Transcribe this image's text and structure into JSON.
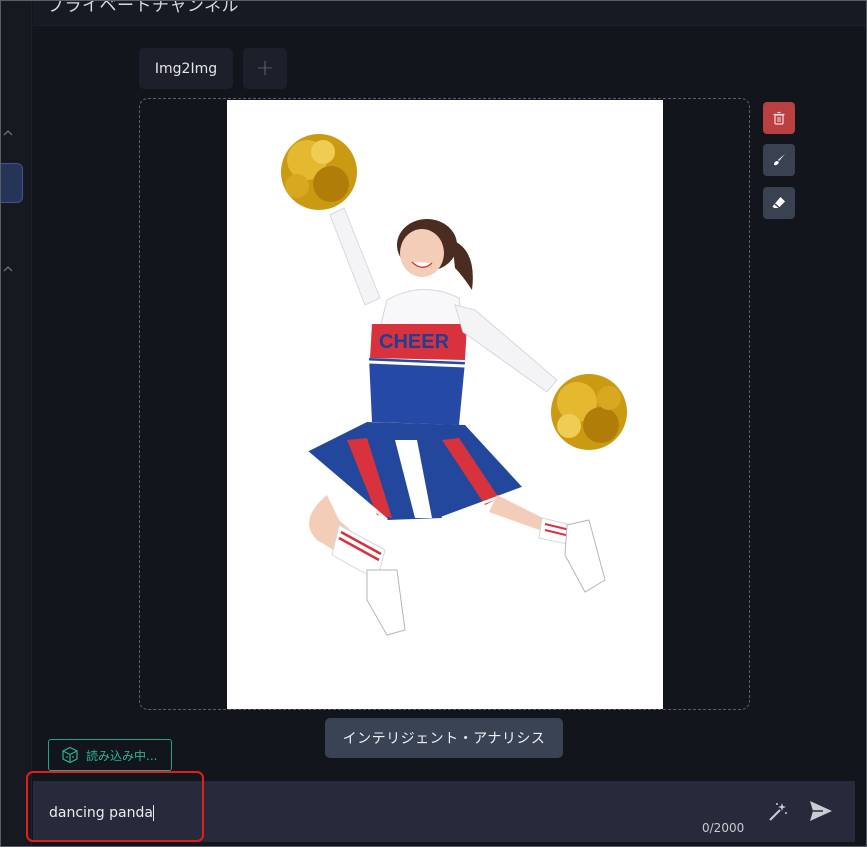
{
  "header": {
    "title": "プライベートチャンネル"
  },
  "tabs": [
    {
      "label": "Img2Img"
    },
    {
      "label": "+"
    }
  ],
  "canvas": {
    "image_alt": "cheerleader jumping with gold pom-poms",
    "uniform_text": "CHEER"
  },
  "tools": {
    "delete_icon": "trash-icon",
    "brush_icon": "brush-icon",
    "eraser_icon": "eraser-icon"
  },
  "analysis_button": {
    "label": "インテリジェント・アナリシス"
  },
  "loading_chip": {
    "label": "読み込み中...",
    "icon": "cube-icon"
  },
  "prompt": {
    "value": "dancing panda",
    "counter": "0/2000"
  },
  "colors": {
    "accent_teal": "#29b495",
    "delete_red": "#b93f40",
    "highlight_red": "#e01e1e",
    "active_blue": "#263457"
  }
}
